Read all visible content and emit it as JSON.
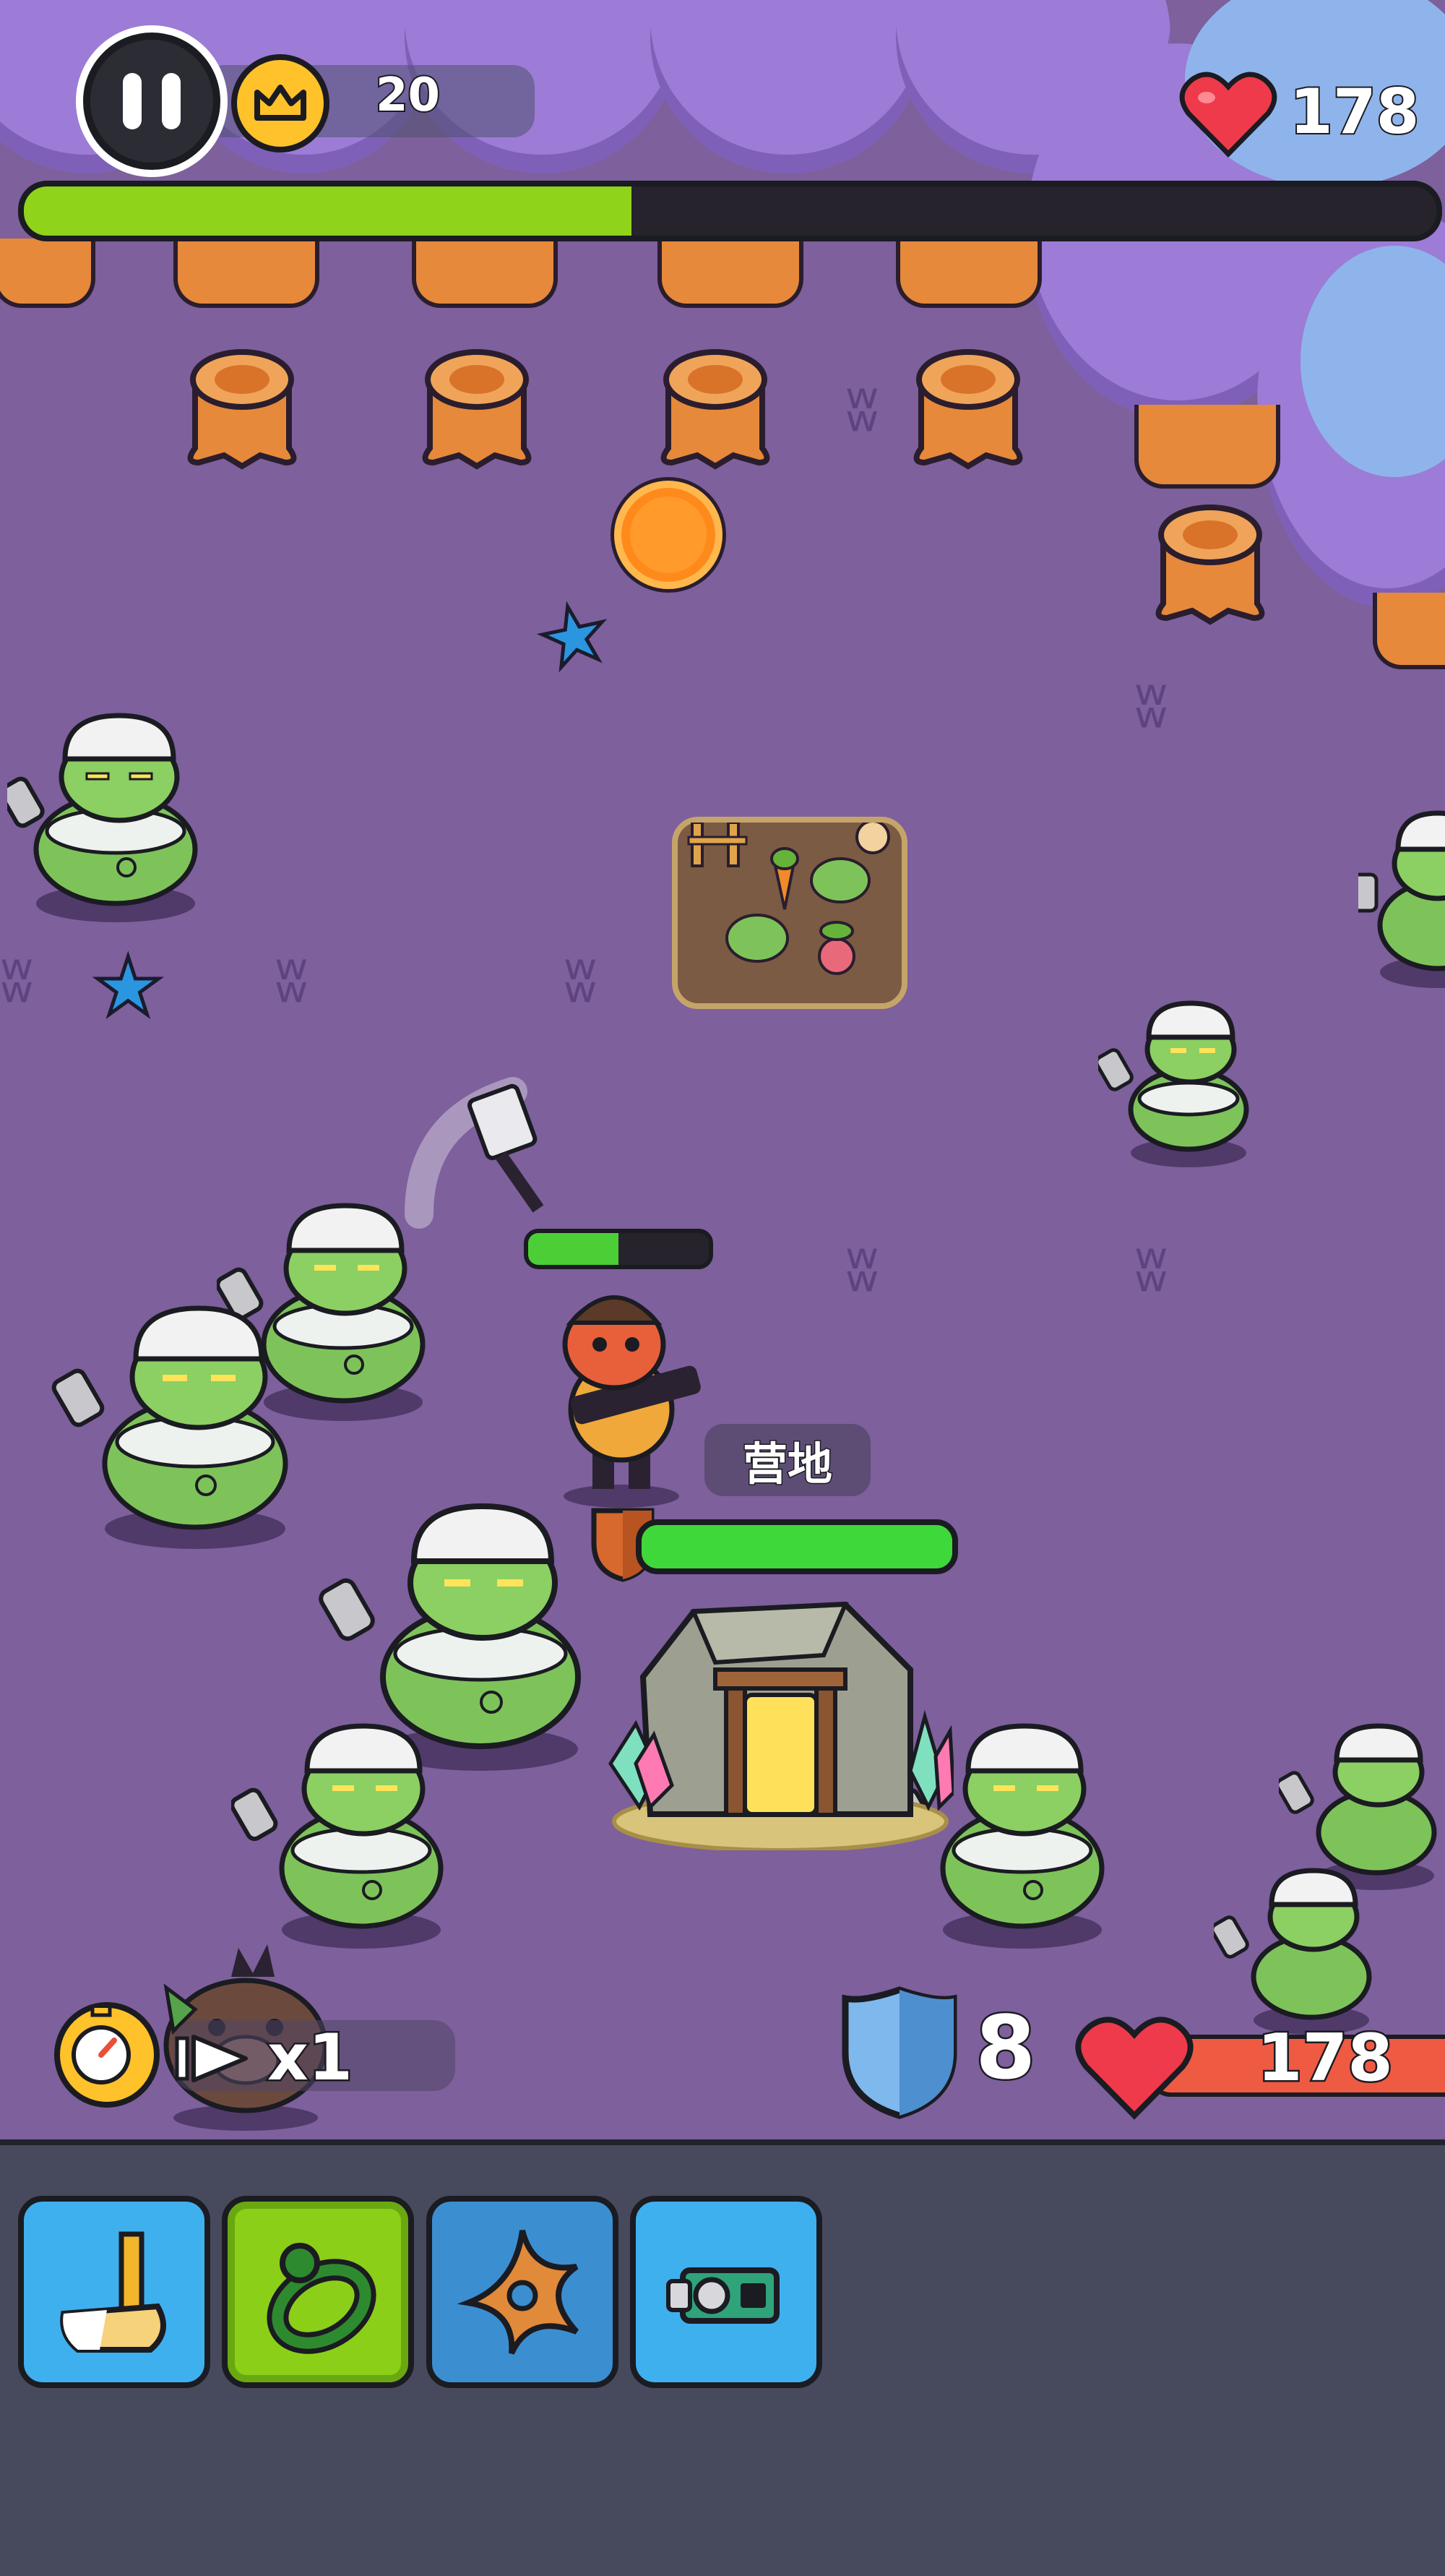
{
  "hud": {
    "crown_count": "20",
    "lives": "178",
    "wave_progress": 0.43
  },
  "camp": {
    "label": "营地",
    "hp_fraction": 1.0
  },
  "hero": {
    "hp_fraction": 0.5
  },
  "speed": {
    "label": "x1"
  },
  "stats": {
    "shield": "8",
    "health": "178"
  },
  "skills": [
    {
      "name": "hammer",
      "selected": false
    },
    {
      "name": "ring",
      "selected": true
    },
    {
      "name": "shuriken",
      "selected": false
    },
    {
      "name": "gadget",
      "selected": false
    }
  ],
  "colors": {
    "field": "#7d609c",
    "progress": "#8fd31a",
    "camp_hp": "#3fd83a",
    "tray": "#464a5c",
    "skill_blue": "#3fb0ee",
    "skill_green": "#8ccf18"
  }
}
